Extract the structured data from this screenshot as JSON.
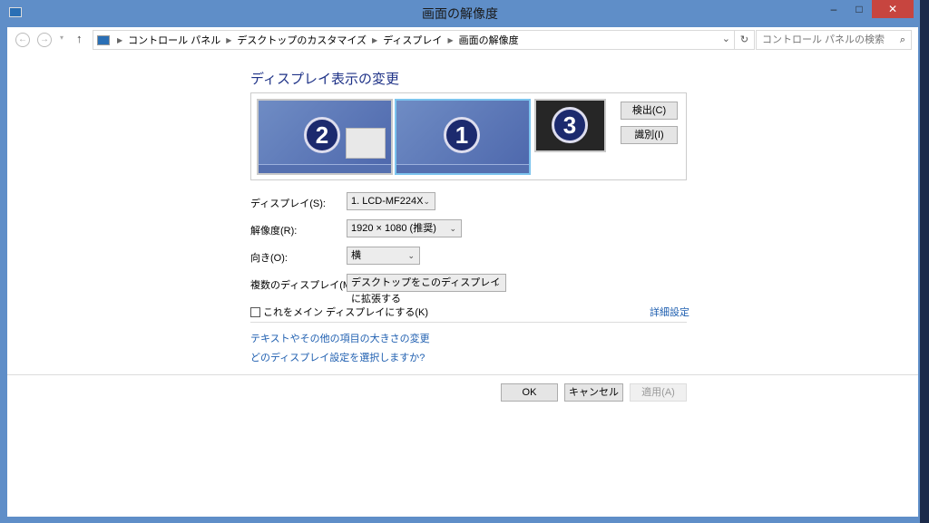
{
  "window": {
    "title": "画面の解像度",
    "minimize": "–",
    "maximize": "□",
    "close": "✕"
  },
  "nav": {
    "back": "←",
    "forward": "→",
    "up": "↑",
    "breadcrumbs": [
      "コントロール パネル",
      "デスクトップのカスタマイズ",
      "ディスプレイ",
      "画面の解像度"
    ],
    "dropdown": "⌄",
    "refresh": "↻",
    "search_placeholder": "コントロール パネルの検索",
    "search_icon": "⌕"
  },
  "main": {
    "heading": "ディスプレイ表示の変更",
    "monitors": [
      {
        "number": "2"
      },
      {
        "number": "1",
        "selected": true
      },
      {
        "number": "3"
      }
    ],
    "detect": "検出(C)",
    "identify": "識別(I)",
    "fields": [
      {
        "label": "ディスプレイ(S):",
        "value": "1. LCD-MF224X"
      },
      {
        "label": "解像度(R):",
        "value": "1920 × 1080 (推奨)"
      },
      {
        "label": "向き(O):",
        "value": "横"
      },
      {
        "label": "複数のディスプレイ(M):",
        "value": "デスクトップをこのディスプレイに拡張する"
      }
    ],
    "main_display_checkbox": "これをメイン ディスプレイにする(K)",
    "advanced": "詳細設定",
    "link_text_size": "テキストやその他の項目の大きさの変更",
    "link_which": "どのディスプレイ設定を選択しますか?"
  },
  "footer": {
    "ok": "OK",
    "cancel": "キャンセル",
    "apply": "適用(A)"
  }
}
